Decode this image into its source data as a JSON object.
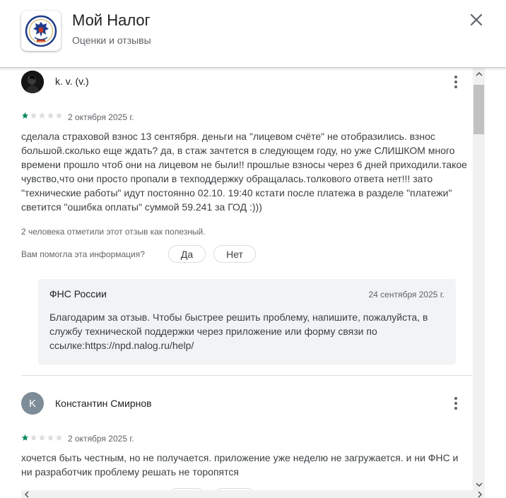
{
  "app": {
    "title": "Мой Налог",
    "subtitle": "Оценки и отзывы",
    "icon": "fns-emblem-icon"
  },
  "reviews": [
    {
      "author": "k. v. (v.)",
      "avatar": "photo-avatar",
      "rating": 1,
      "max_rating": 5,
      "date": "2 октября 2025 г.",
      "text": "сделала страховой взнос 13 сентября. деньги на \"лицевом счёте\" не отобразились. взнос большой.сколько еще ждать? да, в стаж зачтется в следующем году, но уже СЛИШКОМ много времени прошло чтоб они на лицевом не были!! прошлые взносы через 6 дней приходили.такое чувство,что они просто пропали в техподдержку обращалась.толкового ответа нет!!! зато \"технические работы\" идут постоянно 02.10. 19:40 кстати после платежа в разделе \"платежи\" светится \"ошибка оплаты\" суммой 59.241 за ГОД :)))",
      "helpful_count": "2 человека отметили этот отзыв как полезный.",
      "helpful_question": "Вам помогла эта информация?",
      "yes_label": "Да",
      "no_label": "Нет",
      "reply": {
        "author": "ФНС России",
        "date": "24 сентября 2025 г.",
        "text": "Благодарим за отзыв. Чтобы быстрее решить проблему, напишите, пожалуйста, в службу технической поддержки через приложение или форму связи по ссылке:https://npd.nalog.ru/help/"
      }
    },
    {
      "author": "Константин Смирнов",
      "avatar_letter": "K",
      "rating": 1,
      "max_rating": 5,
      "date": "2 октября 2025 г.",
      "text": "хочется быть честным, но не получается. приложение уже неделю не загружается. и ни ФНС и ни разработчик проблему решать не торопятся"
    }
  ],
  "colors": {
    "star_filled": "#01875f",
    "star_empty": "#dadce0",
    "avatar_letter_bg": "#7d8c96"
  }
}
